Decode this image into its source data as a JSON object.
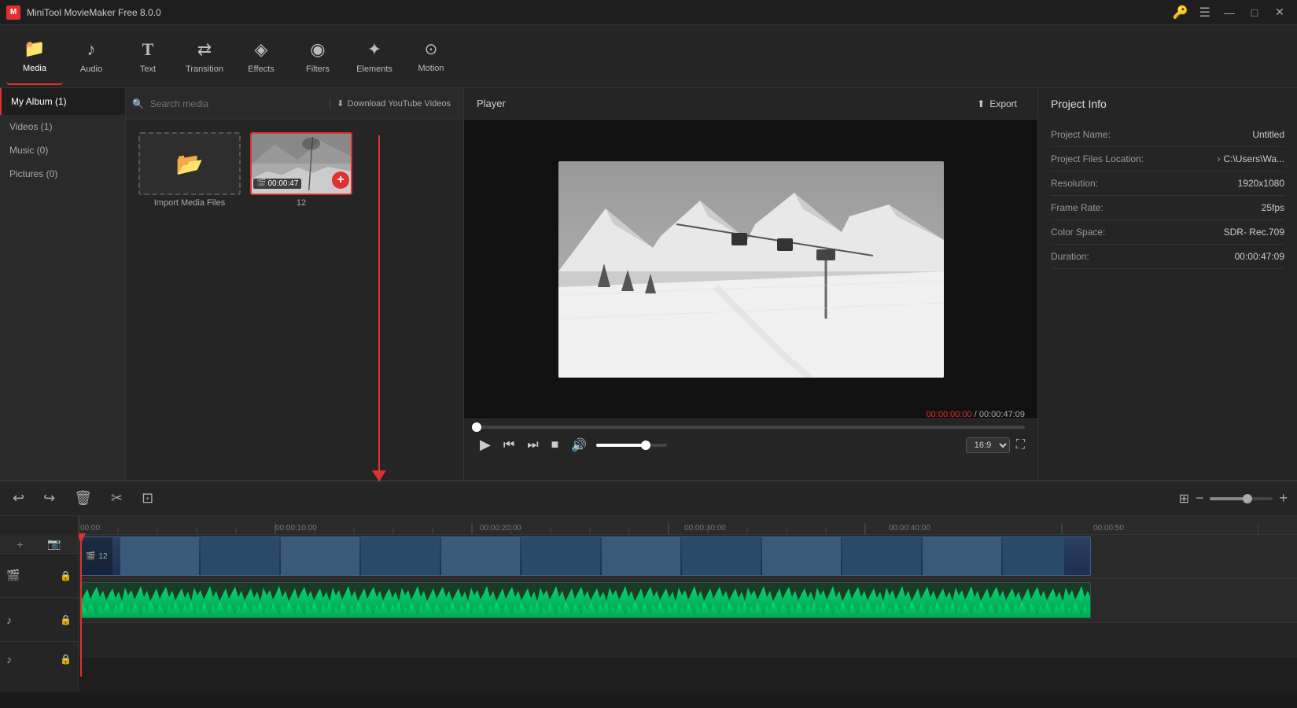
{
  "app": {
    "title": "MiniTool MovieMaker Free 8.0.0"
  },
  "titlebar": {
    "key_icon": "🔑",
    "menu_icon": "☰",
    "minimize": "—",
    "maximize": "□",
    "close": "✕"
  },
  "toolbar": {
    "items": [
      {
        "id": "media",
        "label": "Media",
        "icon": "📁",
        "active": true
      },
      {
        "id": "audio",
        "label": "Audio",
        "icon": "♪"
      },
      {
        "id": "text",
        "label": "Text",
        "icon": "T"
      },
      {
        "id": "transition",
        "label": "Transition",
        "icon": "⇄"
      },
      {
        "id": "effects",
        "label": "Effects",
        "icon": "◈"
      },
      {
        "id": "filters",
        "label": "Filters",
        "icon": "◉"
      },
      {
        "id": "elements",
        "label": "Elements",
        "icon": "✦"
      },
      {
        "id": "motion",
        "label": "Motion",
        "icon": "○"
      }
    ]
  },
  "sidebar": {
    "my_album": "My Album (1)",
    "categories": [
      {
        "label": "Videos (1)"
      },
      {
        "label": "Music (0)"
      },
      {
        "label": "Pictures (0)"
      }
    ]
  },
  "media": {
    "search_placeholder": "Search media",
    "download_label": "Download YouTube Videos",
    "import_label": "Import Media Files",
    "item_number": "12",
    "item_duration": "00:00:47"
  },
  "player": {
    "label": "Player",
    "export_label": "Export",
    "time_current": "00:00:00:00",
    "time_separator": " / ",
    "time_total": "00:00:47:09",
    "aspect_ratio": "16:9",
    "progress_pct": 0
  },
  "project_info": {
    "title": "Project Info",
    "fields": [
      {
        "label": "Project Name:",
        "value": "Untitled"
      },
      {
        "label": "Project Files Location:",
        "value": "C:\\Users\\Wa..."
      },
      {
        "label": "Resolution:",
        "value": "1920x1080"
      },
      {
        "label": "Frame Rate:",
        "value": "25fps"
      },
      {
        "label": "Color Space:",
        "value": "SDR- Rec.709"
      },
      {
        "label": "Duration:",
        "value": "00:00:47:09"
      }
    ]
  },
  "timeline": {
    "ruler_marks": [
      {
        "label": "00:00",
        "pct": 0
      },
      {
        "label": "00:00:10:00",
        "pct": 18
      },
      {
        "label": "00:00:20:00",
        "pct": 36
      },
      {
        "label": "00:00:30:00",
        "pct": 54
      },
      {
        "label": "00:00:40:00",
        "pct": 72
      },
      {
        "label": "00:00:50",
        "pct": 90
      }
    ],
    "video_track_icon": "🎬",
    "audio_track_icon": "♪",
    "clip_label": "12"
  },
  "icons": {
    "undo": "↩",
    "redo": "↪",
    "delete": "🗑",
    "cut": "✂",
    "crop": "⊡",
    "split": "⊞",
    "zoom_out": "−",
    "zoom_in": "+",
    "lock": "🔒",
    "film": "🎬",
    "music_note": "♪",
    "search": "🔍",
    "download": "⬇",
    "upload": "⬆",
    "play": "▶",
    "prev_frame": "⏮",
    "next_frame": "⏭",
    "stop": "■",
    "volume": "🔊",
    "fullscreen": "⛶",
    "add_track": "+",
    "folder": "📂"
  }
}
